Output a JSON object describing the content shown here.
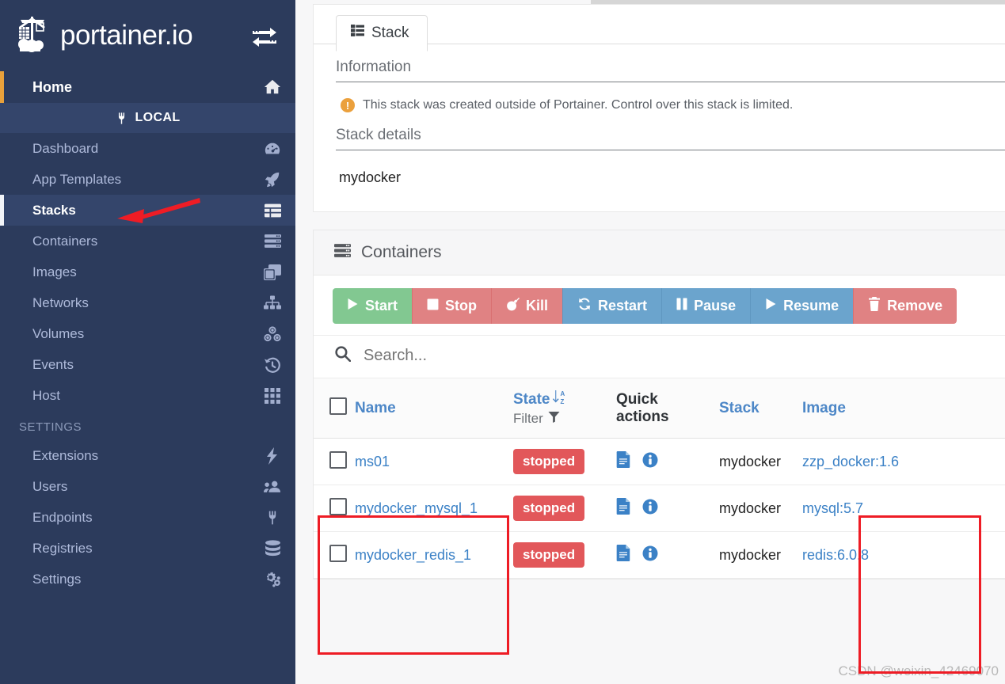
{
  "brand": {
    "name": "portainer.io",
    "switch_icon": "switch-endpoint-icon",
    "logo_icon": "portainer-crane-logo"
  },
  "sidebar": {
    "home": {
      "label": "Home",
      "icon": "home-icon"
    },
    "local_section": {
      "label": "LOCAL",
      "icon": "plug-icon"
    },
    "items": [
      {
        "label": "Dashboard",
        "icon": "dashboard-icon",
        "active": false
      },
      {
        "label": "App Templates",
        "icon": "rocket-icon",
        "active": false
      },
      {
        "label": "Stacks",
        "icon": "stacks-icon",
        "active": true
      },
      {
        "label": "Containers",
        "icon": "containers-icon",
        "active": false
      },
      {
        "label": "Images",
        "icon": "images-icon",
        "active": false
      },
      {
        "label": "Networks",
        "icon": "networks-icon",
        "active": false
      },
      {
        "label": "Volumes",
        "icon": "volumes-icon",
        "active": false
      },
      {
        "label": "Events",
        "icon": "events-icon",
        "active": false
      },
      {
        "label": "Host",
        "icon": "host-icon",
        "active": false
      }
    ],
    "settings_section": {
      "label": "SETTINGS"
    },
    "settings_items": [
      {
        "label": "Extensions",
        "icon": "bolt-icon"
      },
      {
        "label": "Users",
        "icon": "users-icon"
      },
      {
        "label": "Endpoints",
        "icon": "plug-icon"
      },
      {
        "label": "Registries",
        "icon": "database-icon"
      },
      {
        "label": "Settings",
        "icon": "gears-icon"
      }
    ]
  },
  "stack_panel": {
    "tab_label": "Stack",
    "tab_icon": "list-icon",
    "information_title": "Information",
    "information_text": "This stack was created outside of Portainer. Control over this stack is limited.",
    "warning_icon": "exclamation-circle-icon",
    "stack_details_title": "Stack details",
    "stack_name": "mydocker"
  },
  "containers_panel": {
    "title": "Containers",
    "title_icon": "containers-icon",
    "actions": [
      {
        "label": "Start",
        "icon": "play-icon",
        "color": "green"
      },
      {
        "label": "Stop",
        "icon": "stop-icon",
        "color": "red"
      },
      {
        "label": "Kill",
        "icon": "bomb-icon",
        "color": "red"
      },
      {
        "label": "Restart",
        "icon": "restart-icon",
        "color": "blue"
      },
      {
        "label": "Pause",
        "icon": "pause-icon",
        "color": "blue"
      },
      {
        "label": "Resume",
        "icon": "play-icon",
        "color": "blue"
      },
      {
        "label": "Remove",
        "icon": "trash-icon",
        "color": "red"
      }
    ],
    "search": {
      "placeholder": "Search...",
      "value": "",
      "icon": "search-icon"
    },
    "columns": {
      "name": "Name",
      "state": "State",
      "state_sort_icon": "sort-alpha-desc-icon",
      "filter": "Filter",
      "filter_icon": "funnel-icon",
      "quick_actions": "Quick actions",
      "stack": "Stack",
      "image": "Image"
    },
    "rows": [
      {
        "name": "ms01",
        "state": "stopped",
        "stack": "mydocker",
        "image": "zzp_docker:1.6"
      },
      {
        "name": "mydocker_mysql_1",
        "state": "stopped",
        "stack": "mydocker",
        "image": "mysql:5.7"
      },
      {
        "name": "mydocker_redis_1",
        "state": "stopped",
        "stack": "mydocker",
        "image": "redis:6.0.8"
      }
    ],
    "row_quick_action_icons": [
      "logs-file-icon",
      "inspect-info-icon"
    ]
  },
  "annotations": {
    "arrow_to": "Stacks",
    "highlight_name_column": true,
    "highlight_image_column": true
  },
  "watermark": "CSDN @weixin_42469070",
  "colors": {
    "sidebar_bg": "#2c3b5c",
    "sidebar_active_bg": "#34456b",
    "home_accent": "#e9a13b",
    "link_blue": "#3b81c6",
    "badge_red": "#e2575a",
    "btn_green": "#82c891",
    "btn_red": "#e08283",
    "btn_blue": "#6ba4cd",
    "warning_orange": "#eba03c",
    "annotation_red": "#ee1c25"
  }
}
